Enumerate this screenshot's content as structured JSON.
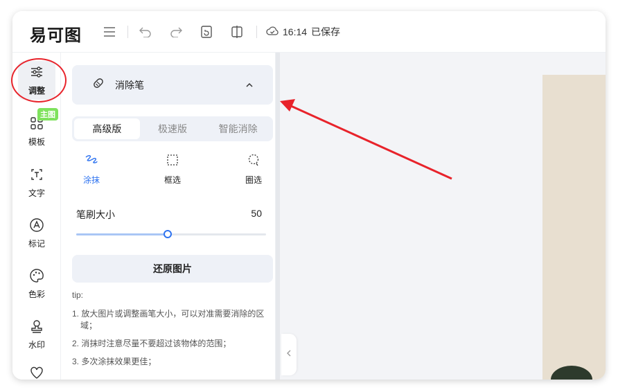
{
  "app": {
    "logo": "易可图",
    "save_time": "16:14",
    "save_label": "已保存"
  },
  "toolbar": {
    "icons": [
      "menu-icon",
      "undo-icon",
      "redo-icon",
      "history-icon",
      "compare-icon",
      "cloud-icon"
    ]
  },
  "leftnav": {
    "items": [
      {
        "label": "调整",
        "icon": "sliders-icon",
        "active": true
      },
      {
        "label": "模板",
        "icon": "template-icon",
        "badge": "主图"
      },
      {
        "label": "文字",
        "icon": "text-icon"
      },
      {
        "label": "标记",
        "icon": "marker-icon"
      },
      {
        "label": "色彩",
        "icon": "palette-icon"
      },
      {
        "label": "水印",
        "icon": "stamp-icon"
      }
    ]
  },
  "panel": {
    "tool_title": "消除笔",
    "tabs": [
      "高级版",
      "极速版",
      "智能消除"
    ],
    "active_tab": "高级版",
    "modes": [
      {
        "label": "涂抹",
        "active": true
      },
      {
        "label": "框选"
      },
      {
        "label": "圈选"
      }
    ],
    "brush_size_label": "笔刷大小",
    "brush_size_value": "50",
    "brush_size_fraction": 0.48,
    "restore_button": "还原图片",
    "tips_title": "tip:",
    "tips": [
      "1. 放大图片或调整画笔大小，可以对准需要消除的区域；",
      "2. 消抹时注意尽量不要超过该物体的范围；",
      "3. 多次涂抹效果更佳；"
    ]
  },
  "colors": {
    "accent": "#2e73f0",
    "annotation": "#e8232b",
    "badge": "#7fe25d"
  }
}
